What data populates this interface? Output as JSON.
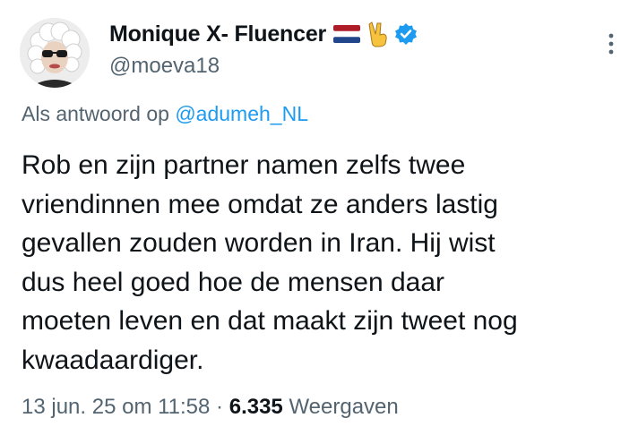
{
  "author": {
    "display_name": "Monique X- Fluencer",
    "handle": "@moeva18",
    "emoji": [
      "netherlands-flag",
      "victory-hand"
    ],
    "verified": true
  },
  "reply": {
    "prefix": "Als antwoord op",
    "to": "@adumeh_NL"
  },
  "tweet": {
    "lines": [
      "Rob en zijn partner namen zelfs twee",
      "vriendinnen mee omdat ze anders lastig",
      "gevallen zouden worden in Iran. Hij wist",
      "dus heel goed hoe de mensen daar",
      "moeten leven en dat maakt zijn tweet nog",
      "kwaadaardiger."
    ]
  },
  "meta": {
    "date": "13 jun. 25 om 11:58",
    "separator": "·",
    "views_count": "6.335",
    "views_label": "Weergaven"
  },
  "colors": {
    "text": "#0f1419",
    "secondary": "#536471",
    "link": "#1d9bf0",
    "verified_badge": "#1d9bf0"
  }
}
